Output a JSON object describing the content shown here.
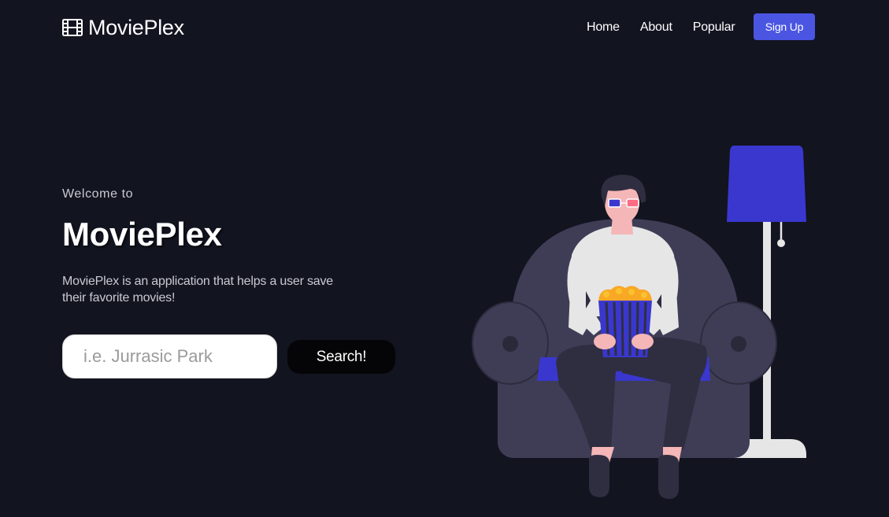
{
  "nav": {
    "brand": "MoviePlex",
    "brand_icon": "film-icon",
    "links": [
      "Home",
      "About",
      "Popular"
    ],
    "signup_label": "Sign Up"
  },
  "hero": {
    "welcome": "Welcome to",
    "title": "MoviePlex",
    "description": "MoviePlex is an application that helps a user save their favorite movies!"
  },
  "search": {
    "placeholder": "i.e. Jurrasic Park",
    "value": "",
    "button_label": "Search!"
  },
  "colors": {
    "background": "#121420",
    "accent": "#4a55e2",
    "chair": "#3f3d56",
    "lamp_shade": "#3a37cf"
  }
}
